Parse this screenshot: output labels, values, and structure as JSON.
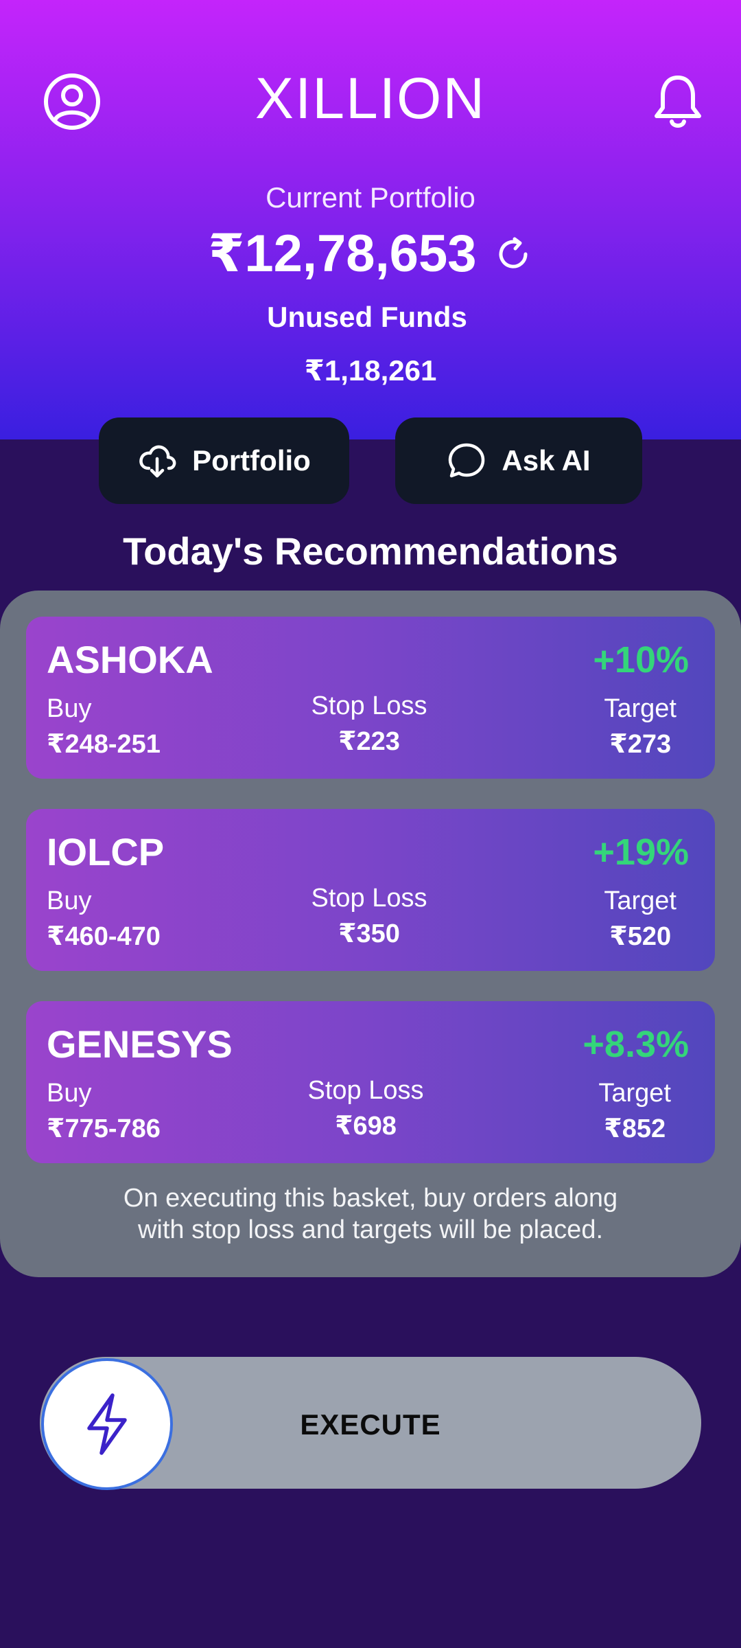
{
  "header": {
    "app_title": "XILLION",
    "profile_icon": "user-circle-icon",
    "notification_icon": "bell-icon"
  },
  "portfolio": {
    "label": "Current Portfolio",
    "value": "₹12,78,653",
    "refresh_icon": "refresh-icon",
    "unused_label": "Unused Funds",
    "unused_value": "₹1,18,261"
  },
  "actions": {
    "portfolio_label": "Portfolio",
    "portfolio_icon": "cloud-download-icon",
    "ask_ai_label": "Ask AI",
    "ask_ai_icon": "chat-bubble-icon"
  },
  "recommendations": {
    "title": "Today's Recommendations",
    "buy_label": "Buy",
    "stop_loss_label": "Stop Loss",
    "target_label": "Target",
    "items": [
      {
        "symbol": "ASHOKA",
        "change": "+10%",
        "buy": "₹248-251",
        "stop_loss": "₹223",
        "target": "₹273"
      },
      {
        "symbol": "IOLCP",
        "change": "+19%",
        "buy": "₹460-470",
        "stop_loss": "₹350",
        "target": "₹520"
      },
      {
        "symbol": "GENESYS",
        "change": "+8.3%",
        "buy": "₹775-786",
        "stop_loss": "₹698",
        "target": "₹852"
      }
    ],
    "disclaimer_line1": "On executing this basket, buy orders along",
    "disclaimer_line2": "with stop loss and targets will be placed."
  },
  "execute": {
    "label": "EXECUTE",
    "icon": "lightning-bolt-icon"
  },
  "colors": {
    "header_top": "#c424fb",
    "header_bottom": "#3a1fe0",
    "background": "#2a105c",
    "panel": "#6b7280",
    "positive": "#34d57a",
    "button_dark": "#111827",
    "slider_track": "#9ca3af",
    "knob_border": "#3b6fe0"
  }
}
